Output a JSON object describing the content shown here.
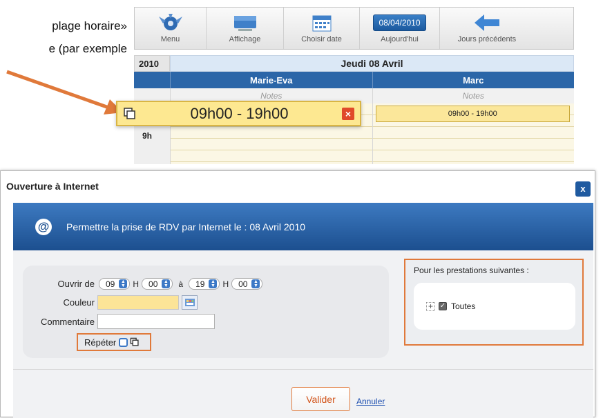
{
  "caption": {
    "line1": "plage horaire»",
    "line2": "e (par exemple"
  },
  "toolbar": {
    "menu": "Menu",
    "affichage": "Affichage",
    "choisir_date": "Choisir date",
    "today_date": "08/04/2010",
    "aujourdhui": "Aujourd'hui",
    "jours_precedents": "Jours précédents"
  },
  "calendar": {
    "year": "2010",
    "day": "Jeudi 08 Avril",
    "columns": [
      "Marie-Eva",
      "Marc"
    ],
    "notes": [
      "Notes",
      "Notes"
    ],
    "hour": "9h",
    "marc_slot": "09h00 - 19h00"
  },
  "highlight_slot": {
    "time": "09h00 - 19h00",
    "close": "×"
  },
  "dialog": {
    "title": "Ouverture à Internet",
    "close": "x",
    "banner": "Permettre la prise de RDV par Internet le : 08 Avril 2010",
    "banner_icon": "@",
    "form": {
      "ouvrir_label": "Ouvrir de",
      "from_hour": "09",
      "from_min": "00",
      "h_sep": "H",
      "to_label": "à",
      "to_hour": "19",
      "to_min": "00",
      "couleur_label": "Couleur",
      "commentaire_label": "Commentaire",
      "commentaire_value": "",
      "repeter_label": "Répéter"
    },
    "prestations": {
      "title": "Pour les prestations suivantes :",
      "item": "Toutes"
    },
    "valider": "Valider",
    "annuler": "Annuler"
  },
  "colors": {
    "accent_blue": "#2b66a8",
    "slot_yellow": "#fde891",
    "highlight_orange": "#e0793a"
  }
}
